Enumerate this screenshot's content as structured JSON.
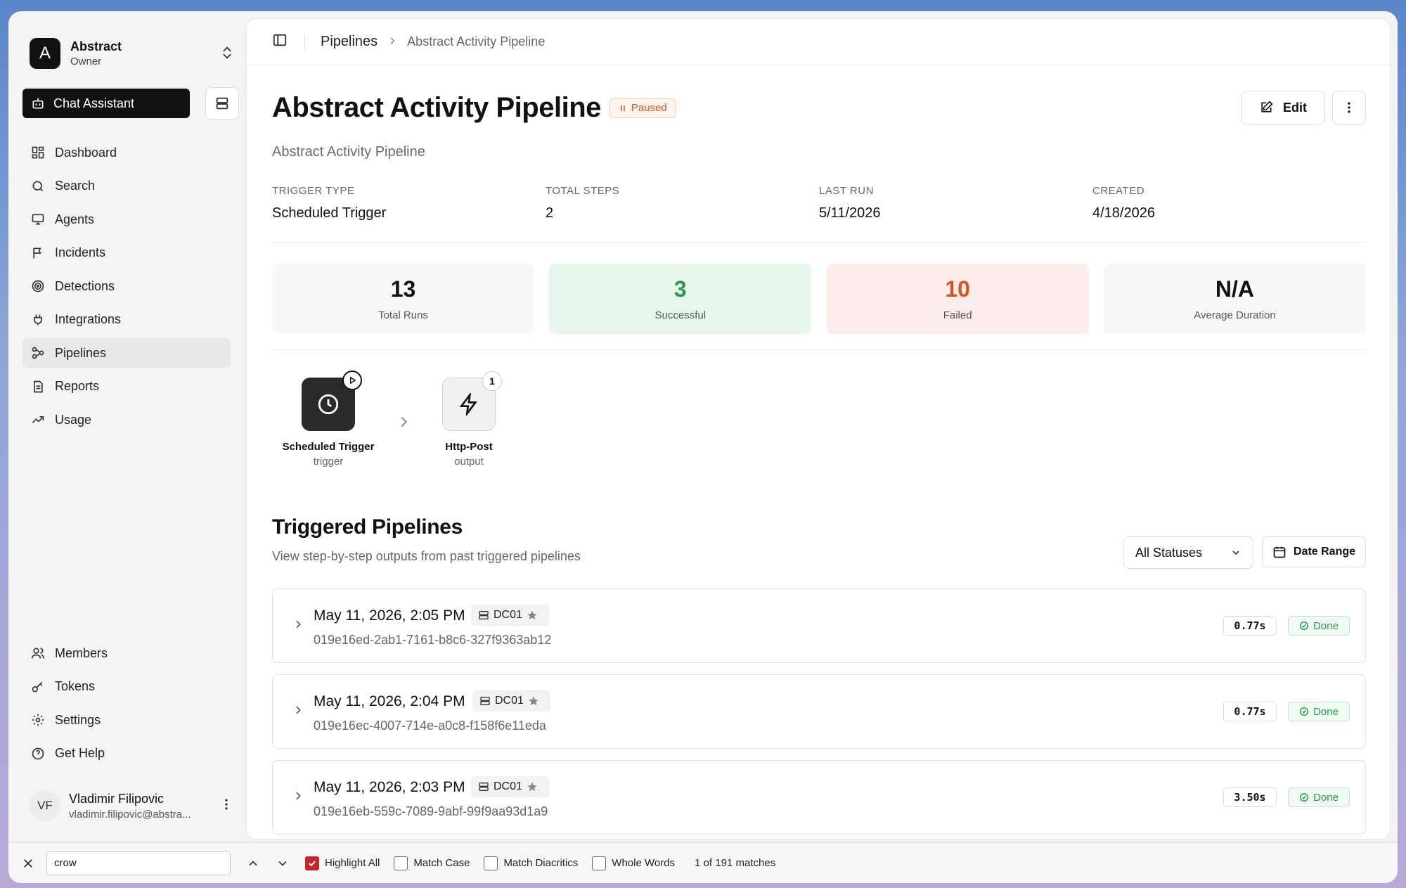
{
  "org": {
    "initial": "A",
    "name": "Abstract",
    "role": "Owner"
  },
  "sidebar": {
    "chat_label": "Chat Assistant",
    "items": [
      {
        "label": "Dashboard",
        "icon": "dashboard-icon"
      },
      {
        "label": "Search",
        "icon": "search-icon"
      },
      {
        "label": "Agents",
        "icon": "monitor-icon"
      },
      {
        "label": "Incidents",
        "icon": "flag-icon"
      },
      {
        "label": "Detections",
        "icon": "target-icon"
      },
      {
        "label": "Integrations",
        "icon": "plug-icon"
      },
      {
        "label": "Pipelines",
        "icon": "workflow-icon",
        "active": true
      },
      {
        "label": "Reports",
        "icon": "file-icon"
      },
      {
        "label": "Usage",
        "icon": "trending-icon"
      }
    ],
    "bottom_items": [
      {
        "label": "Members",
        "icon": "users-icon"
      },
      {
        "label": "Tokens",
        "icon": "key-icon"
      },
      {
        "label": "Settings",
        "icon": "gear-icon"
      },
      {
        "label": "Get Help",
        "icon": "help-icon"
      }
    ]
  },
  "user": {
    "initials": "VF",
    "name": "Vladimir Filipovic",
    "email": "vladimir.filipovic@abstra..."
  },
  "breadcrumb": {
    "root": "Pipelines",
    "current": "Abstract Activity Pipeline"
  },
  "page": {
    "title": "Abstract Activity Pipeline",
    "status": "Paused",
    "subtitle": "Abstract Activity Pipeline",
    "edit_label": "Edit"
  },
  "meta": [
    {
      "label": "TRIGGER TYPE",
      "value": "Scheduled Trigger"
    },
    {
      "label": "TOTAL STEPS",
      "value": "2"
    },
    {
      "label": "LAST RUN",
      "value": "5/11/2026"
    },
    {
      "label": "CREATED",
      "value": "4/18/2026"
    }
  ],
  "stats": [
    {
      "value": "13",
      "label": "Total Runs"
    },
    {
      "value": "3",
      "label": "Successful"
    },
    {
      "value": "10",
      "label": "Failed"
    },
    {
      "value": "N/A",
      "label": "Average Duration"
    }
  ],
  "flow": [
    {
      "name": "Scheduled Trigger",
      "type": "trigger",
      "icon": "clock-icon"
    },
    {
      "name": "Http-Post",
      "type": "output",
      "icon": "bolt-icon",
      "badge": "1"
    }
  ],
  "triggered": {
    "title": "Triggered Pipelines",
    "subtitle": "View step-by-step outputs from past triggered pipelines",
    "status_filter": "All Statuses",
    "date_label": "Date Range",
    "runs": [
      {
        "date": "May 11, 2026, 2:05 PM",
        "tag": "DC01",
        "id": "019e16ed-2ab1-7161-b8c6-327f9363ab12",
        "duration": "0.77s",
        "status": "Done"
      },
      {
        "date": "May 11, 2026, 2:04 PM",
        "tag": "DC01",
        "id": "019e16ec-4007-714e-a0c8-f158f6e11eda",
        "duration": "0.77s",
        "status": "Done"
      },
      {
        "date": "May 11, 2026, 2:03 PM",
        "tag": "DC01",
        "id": "019e16eb-559c-7089-9abf-99f9aa93d1a9",
        "duration": "3.50s",
        "status": "Done"
      }
    ]
  },
  "findbar": {
    "query": "crow",
    "options": [
      {
        "label": "Highlight All",
        "checked": true
      },
      {
        "label": "Match Case",
        "checked": false
      },
      {
        "label": "Match Diacritics",
        "checked": false
      },
      {
        "label": "Whole Words",
        "checked": false
      }
    ],
    "count": "1 of 191 matches"
  }
}
